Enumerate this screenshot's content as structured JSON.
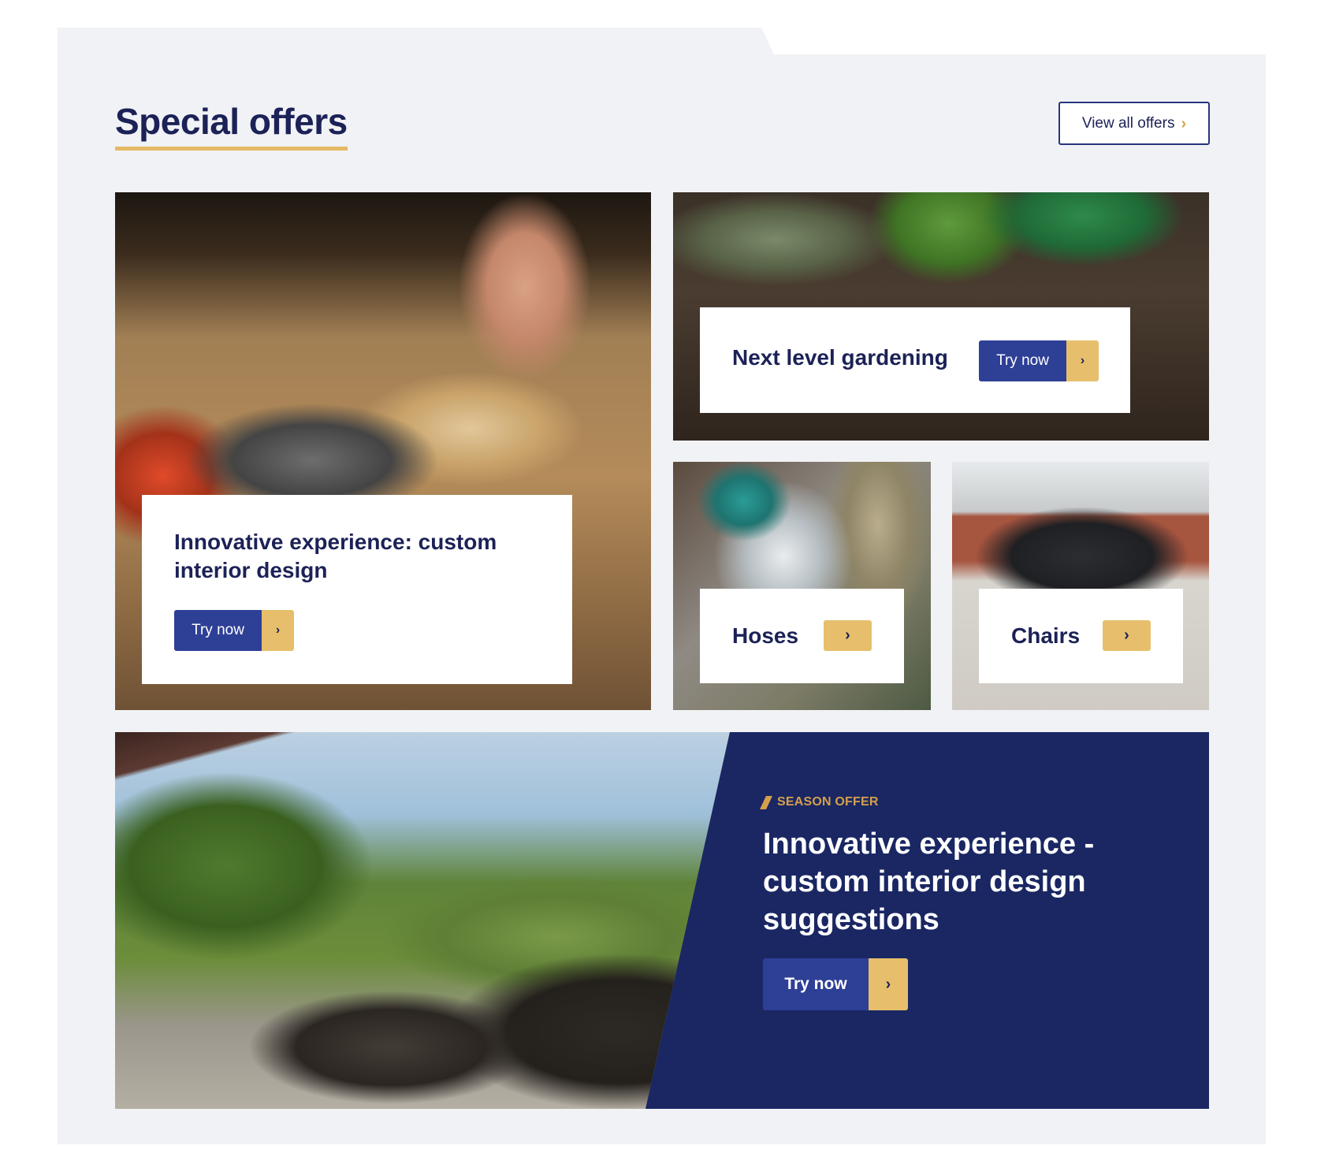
{
  "section": {
    "title": "Special offers",
    "view_all_label": "View all offers",
    "view_all_chevron": "›"
  },
  "cards": {
    "interior": {
      "title": "Innovative experience: custom interior design",
      "cta_label": "Try now",
      "cta_arrow": "›"
    },
    "gardening": {
      "title": "Next level gardening",
      "cta_label": "Try now",
      "cta_arrow": "›"
    },
    "hoses": {
      "title": "Hoses",
      "cta_arrow": "›"
    },
    "chairs": {
      "title": "Chairs",
      "cta_arrow": "›"
    }
  },
  "banner": {
    "eyebrow": "SEASON OFFER",
    "title": "Innovative experience - custom interior design suggestions",
    "cta_label": "Try now",
    "cta_arrow": "›"
  },
  "colors": {
    "navy": "#1c2257",
    "banner_bg": "#1a2763",
    "button_blue": "#2e3f96",
    "accent_gold": "#e7bf6c",
    "panel_bg": "#f1f2f5"
  }
}
